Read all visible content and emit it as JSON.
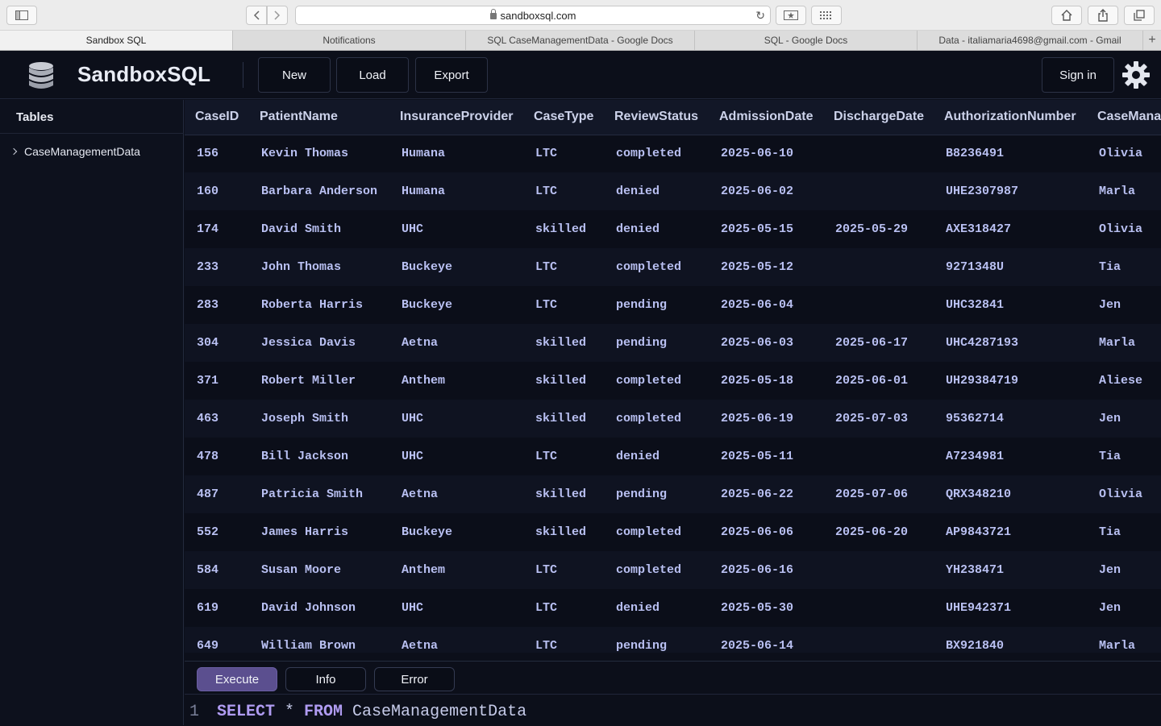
{
  "browser": {
    "url": "sandboxsql.com",
    "tabs": [
      {
        "label": "Sandbox SQL",
        "active": true
      },
      {
        "label": "Notifications",
        "active": false
      },
      {
        "label": "SQL CaseManagementData - Google Docs",
        "active": false
      },
      {
        "label": "SQL - Google Docs",
        "active": false
      },
      {
        "label": "Data - italiamaria4698@gmail.com - Gmail",
        "active": false
      }
    ]
  },
  "header": {
    "brand": "SandboxSQL",
    "new_label": "New",
    "load_label": "Load",
    "export_label": "Export",
    "signin_label": "Sign in"
  },
  "sidebar": {
    "title": "Tables",
    "items": [
      {
        "label": "CaseManagementData"
      }
    ]
  },
  "table": {
    "columns": [
      "CaseID",
      "PatientName",
      "InsuranceProvider",
      "CaseType",
      "ReviewStatus",
      "AdmissionDate",
      "DischargeDate",
      "AuthorizationNumber",
      "CaseManager"
    ],
    "rows": [
      [
        "156",
        "Kevin Thomas",
        "Humana",
        "LTC",
        "completed",
        "2025-06-10",
        "",
        "B8236491",
        "Olivia"
      ],
      [
        "160",
        "Barbara Anderson",
        "Humana",
        "LTC",
        "denied",
        "2025-06-02",
        "",
        "UHE2307987",
        "Marla"
      ],
      [
        "174",
        "David Smith",
        "UHC",
        "skilled",
        "denied",
        "2025-05-15",
        "2025-05-29",
        "AXE318427",
        "Olivia"
      ],
      [
        "233",
        "John Thomas",
        "Buckeye",
        "LTC",
        "completed",
        "2025-05-12",
        "",
        "9271348U",
        "Tia"
      ],
      [
        "283",
        "Roberta Harris",
        "Buckeye",
        "LTC",
        "pending",
        "2025-06-04",
        "",
        "UHC32841",
        "Jen"
      ],
      [
        "304",
        "Jessica Davis",
        "Aetna",
        "skilled",
        "pending",
        "2025-06-03",
        "2025-06-17",
        "UHC4287193",
        "Marla"
      ],
      [
        "371",
        "Robert Miller",
        "Anthem",
        "skilled",
        "completed",
        "2025-05-18",
        "2025-06-01",
        "UH29384719",
        "Aliese"
      ],
      [
        "463",
        "Joseph Smith",
        "UHC",
        "skilled",
        "completed",
        "2025-06-19",
        "2025-07-03",
        "95362714",
        "Jen"
      ],
      [
        "478",
        "Bill Jackson",
        "UHC",
        "LTC",
        "denied",
        "2025-05-11",
        "",
        "A7234981",
        "Tia"
      ],
      [
        "487",
        "Patricia Smith",
        "Aetna",
        "skilled",
        "pending",
        "2025-06-22",
        "2025-07-06",
        "QRX348210",
        "Olivia"
      ],
      [
        "552",
        "James Harris",
        "Buckeye",
        "skilled",
        "completed",
        "2025-06-06",
        "2025-06-20",
        "AP9843721",
        "Tia"
      ],
      [
        "584",
        "Susan Moore",
        "Anthem",
        "LTC",
        "completed",
        "2025-06-16",
        "",
        "YH238471",
        "Jen"
      ],
      [
        "619",
        "David Johnson",
        "UHC",
        "LTC",
        "denied",
        "2025-05-30",
        "",
        "UHE942371",
        "Jen"
      ],
      [
        "649",
        "William Brown",
        "Aetna",
        "LTC",
        "pending",
        "2025-06-14",
        "",
        "BX921840",
        "Marla"
      ]
    ]
  },
  "bottom": {
    "execute_label": "Execute",
    "info_label": "Info",
    "error_label": "Error",
    "editor": {
      "line_number": "1",
      "tokens": [
        {
          "text": "SELECT",
          "kind": "keyword"
        },
        {
          "text": " * ",
          "kind": "plain"
        },
        {
          "text": "FROM",
          "kind": "keyword"
        },
        {
          "text": " CaseManagementData",
          "kind": "plain"
        }
      ]
    }
  },
  "colors": {
    "background": "#0c0f1a",
    "accent": "#5b4f8f",
    "cell_text": "#b9c0f2",
    "keyword": "#b09cf2"
  },
  "icons": [
    "sidebar-toggle-icon",
    "back-icon",
    "forward-icon",
    "lock-icon",
    "reload-icon",
    "bookmark-icon",
    "grid-icon",
    "home-icon",
    "share-icon",
    "tabs-icon",
    "plus-icon",
    "database-icon",
    "gear-icon",
    "chevron-right-icon"
  ]
}
